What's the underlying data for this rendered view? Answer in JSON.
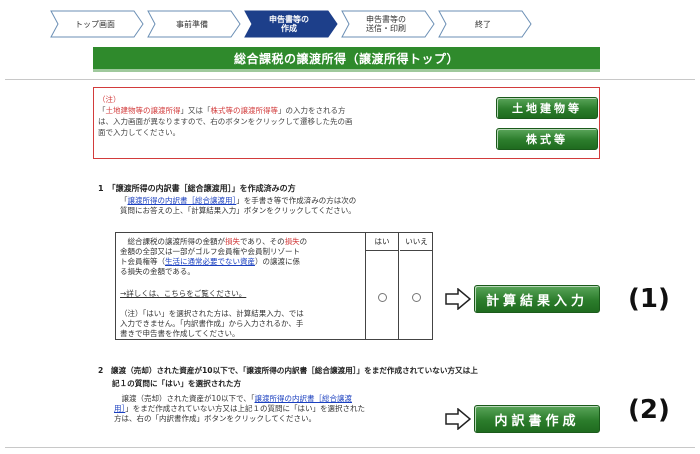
{
  "steps": [
    {
      "label": "トップ画面",
      "active": false
    },
    {
      "label": "事前準備",
      "active": false
    },
    {
      "label": "申告書等の\n作成",
      "active": true
    },
    {
      "label": "申告書等の\n送信・印刷",
      "active": false
    },
    {
      "label": "終了",
      "active": false
    }
  ],
  "page_title": "総合課税の譲渡所得（譲渡所得トップ）",
  "note": {
    "heading": "（注）",
    "line1_pre": "「",
    "line1_red": "土地建物等の譲渡所得",
    "line1_mid": "」又は「",
    "line1_red2": "株式等の譲渡所得等",
    "line1_post": "」の入力をされる方",
    "line2": "は、入力画面が異なりますので、右のボタンをクリックして遷移した先の画",
    "line3": "面で入力してください。"
  },
  "buttons": {
    "land": "土地建物等",
    "stocks": "株式等",
    "calc": "計算結果入力",
    "detail": "内訳書作成"
  },
  "section1": {
    "heading": "1　「譲渡所得の内訳書［総合譲渡用］」を作成済みの方",
    "body_pre": "「",
    "body_link": "譲渡所得の内訳書［総合譲渡用］",
    "body_post": "」を手書き等で作成済みの方は次の",
    "body2": "質問にお答えの上、「計算結果入力」ボタンをクリックしてください。"
  },
  "question": {
    "yes": "はい",
    "no": "いいえ",
    "t1_pre": "総合課税の譲渡所得の金額が",
    "t1_red": "損失",
    "t1_mid": "であり、その",
    "t1_red2": "損失",
    "t1_post": "の",
    "t2": "金額の全部又は一部がゴルフ会員権や会員制リゾート",
    "t3_pre": "ト会員権等（",
    "t3_link": "生活に通常必要でない資産",
    "t3_post": "）の譲渡に係",
    "t4": "る損失の金額である。",
    "detail_link": "→詳しくは、こちらをご覧ください。",
    "n1": "（注）「はい」を選択された方は、計算結果入力、では",
    "n2": "入力できません。「内訳書作成」から入力されるか、手",
    "n3": "書きで申告書を作成してください。"
  },
  "section2": {
    "heading": "2　譲渡（売却）された資産が10以下で、「譲渡所得の内訳書［総合譲渡用］」をまだ作成されていない方又は上",
    "heading2": "記１の質問に「はい」を選択された方",
    "body_pre": "譲渡（売却）された資産が10以下で、「",
    "body_link": "譲渡所得の内訳書［総合譲渡",
    "body_link2": "用］",
    "body_post": "」をまだ作成されていない方又は上記１の質問に「はい」を選択された",
    "body3": "方は、右の「内訳書作成」ボタンをクリックしてください。"
  },
  "labels": {
    "one": "(1)",
    "two": "(2)"
  }
}
